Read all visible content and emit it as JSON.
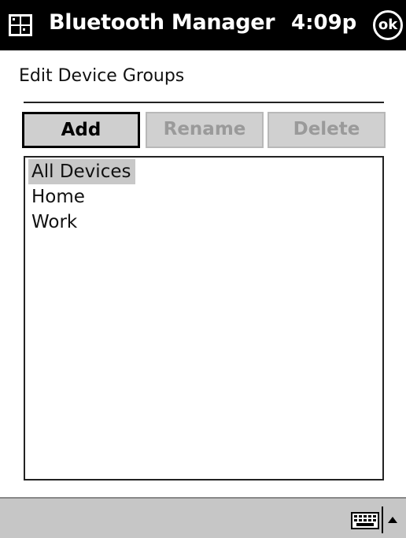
{
  "titlebar": {
    "title": "Bluetooth Manager",
    "time": "4:09p",
    "ok_label": "ok",
    "start_icon": "windows-flag-icon"
  },
  "page": {
    "heading": "Edit Device Groups"
  },
  "toolbar": {
    "add_label": "Add",
    "rename_label": "Rename",
    "delete_label": "Delete"
  },
  "groups": {
    "items": [
      {
        "label": "All Devices",
        "selected": true
      },
      {
        "label": "Home",
        "selected": false
      },
      {
        "label": "Work",
        "selected": false
      }
    ]
  },
  "command_bar": {
    "input_icon": "keyboard-icon",
    "menu_icon": "up-arrow-icon"
  },
  "colors": {
    "titlebar_bg": "#000000",
    "titlebar_fg": "#ffffff",
    "selection": "#c8c8c8",
    "disabled_text": "#9a9a9a",
    "command_bar_bg": "#c6c6c6"
  }
}
